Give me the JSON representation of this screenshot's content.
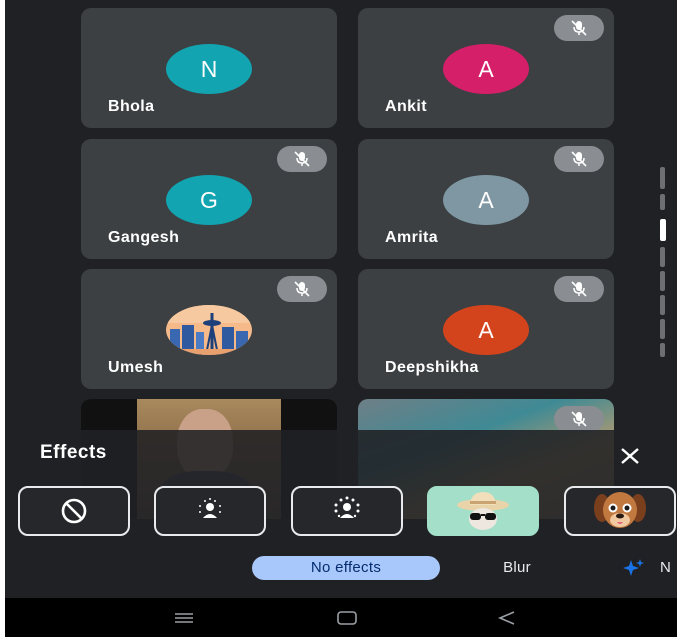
{
  "participants": [
    {
      "name": "Bhola",
      "initial": "N",
      "color": "#12a4b0",
      "muted": false
    },
    {
      "name": "Ankit",
      "initial": "A",
      "color": "#d61f69",
      "muted": true
    },
    {
      "name": "Gangesh",
      "initial": "G",
      "color": "#12a4b0",
      "muted": true
    },
    {
      "name": "Amrita",
      "initial": "A",
      "color": "#7f97a3",
      "muted": true
    },
    {
      "name": "Umesh",
      "initial": "",
      "avatar": "seattle-skyline-image",
      "muted": true
    },
    {
      "name": "Deepshikha",
      "initial": "A",
      "color": "#d4441c",
      "muted": true
    }
  ],
  "effects": {
    "title": "Effects",
    "close_icon": "close-icon",
    "options": [
      {
        "name": "no-effect",
        "icon": "prohibit-icon"
      },
      {
        "name": "slight-blur",
        "icon": "person-blur-light-icon"
      },
      {
        "name": "blur",
        "icon": "person-blur-strong-icon"
      },
      {
        "name": "sun-hat-filter",
        "icon": "hat-sunglasses-image"
      },
      {
        "name": "puppy-filter",
        "icon": "puppy-face-image"
      }
    ],
    "chips": {
      "selected": "No effects",
      "blur": "Blur",
      "next_partial": "N"
    }
  },
  "nav": [
    "menu-icon",
    "home-icon",
    "back-icon"
  ]
}
